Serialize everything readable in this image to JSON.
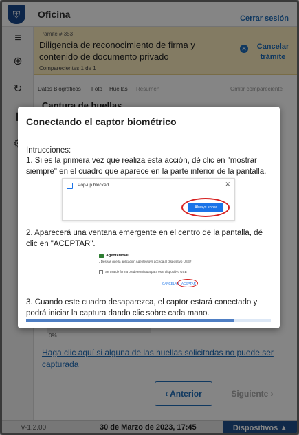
{
  "app": {
    "title": "Oficina",
    "logout_label": "Cerrar sesión"
  },
  "tramite": {
    "number": "Tramite # 353",
    "name": "Diligencia de reconocimiento de firma y contenido de documento privado",
    "comparecientes": "Comparecientes 1 de 1",
    "cancel_label": "Cancelar trámite"
  },
  "steps": {
    "items": [
      "Datos Biográficos",
      "Foto",
      "Huellas",
      "Resumen"
    ],
    "right": "Omitir compareciente"
  },
  "section_title": "Captura de huellas",
  "capture": {
    "percent_label": "0%",
    "help_link": "Haga clic aquí si alguna de las huellas solicitadas no puede ser capturada",
    "prev_label": "Anterior",
    "next_label": "Siguiente"
  },
  "footer": {
    "version": "v-1.2.00",
    "datetime": "30 de Marzo de 2023, 17:45",
    "devices_label": "Dispositivos ▲"
  },
  "modal": {
    "title": "Conectando el captor biométrico",
    "instructions_label": "Intrucciones:",
    "step1": "1. Si es la primera vez que realiza esta acción, dé clic en \"mostrar siempre\" en el cuadro que aparece en la parte inferior de la pantalla.",
    "step2": "2. Aparecerá una ventana emergente en el centro de la pantalla, dé clic en \"ACEPTAR\".",
    "step3": "3. Cuando este cuadro desaparezca, el captor estará conectado y podrá iniciar la captura dando clic sobre cada mano.",
    "progress": 0.85,
    "screenshot1": {
      "blocked_text": "Pop-up blocked",
      "button_text": "Always show"
    },
    "screenshot2": {
      "app_name": "AgenteMovil",
      "question": "¿Deseas que la aplicación AgenteMovil acceda al dispositivo USB?",
      "checkbox_label": "Se usa de forma predeterminada para este dispositivo USB",
      "cancel": "CANCELAR",
      "accept": "ACEPTAR"
    }
  },
  "colors": {
    "accent": "#1e6bb8",
    "banner": "#fbecbf",
    "footer_button": "#1f4f8c",
    "highlight_ring": "#d62020"
  }
}
